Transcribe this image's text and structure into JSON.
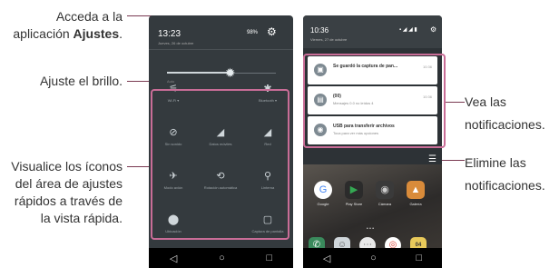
{
  "annotations": {
    "ajustes_pre": "Acceda a la",
    "ajustes_line2_pre": "aplicación ",
    "ajustes_bold": "Ajustes",
    "ajustes_post": ".",
    "brillo": "Ajuste el brillo.",
    "quick_1": "Visualice los íconos",
    "quick_2": "del área de ajustes",
    "quick_3": "rápidos a través de",
    "quick_4": "la vista rápida.",
    "notif_1": "Vea las",
    "notif_2": "notificaciones.",
    "clear_1": "Elimine las",
    "clear_2": "notificaciones."
  },
  "colors": {
    "callout": "#7a3a52",
    "highlight": "#c96d97",
    "phone_bg": "#343a3e"
  },
  "left_phone": {
    "time": "13:23",
    "date": "Jueves, 26 de octubre",
    "battery": "98%",
    "brightness_level": 0.58,
    "tiles": [
      {
        "icon": "wifi-icon",
        "glyph": "⚟",
        "label": "Wi-Fi ▾"
      },
      {
        "icon": "bluetooth-icon",
        "glyph": "✱",
        "label": "Bluetooth ▾"
      },
      {
        "icon": "no-sound-icon",
        "glyph": "⊘",
        "label": "Sin sonido"
      },
      {
        "icon": "data-icon",
        "glyph": "◢",
        "label": "Datos móviles"
      },
      {
        "icon": "signal-icon",
        "glyph": "◢",
        "label": "Red"
      },
      {
        "icon": "airplane-icon",
        "glyph": "✈",
        "label": "Modo avión"
      },
      {
        "icon": "rotate-icon",
        "glyph": "⟲",
        "label": "Rotación automática"
      },
      {
        "icon": "flashlight-icon",
        "glyph": "⚲",
        "label": "Linterna"
      },
      {
        "icon": "location-icon",
        "glyph": "⬤",
        "label": "Ubicación"
      },
      {
        "icon": "capture-icon",
        "glyph": "▢",
        "label": "Captura de pantalla"
      }
    ]
  },
  "right_phone": {
    "time": "10:36",
    "date": "Viernes, 27 de octubre",
    "notifications": [
      {
        "title": "Se guardó la captura de pan...",
        "sub": "",
        "time": "10:36"
      },
      {
        "title": "(00)",
        "sub": "Mensajes 0.0 no leídos 4",
        "time": "10:36"
      },
      {
        "title": "USB para transferir archivos",
        "sub": "Toca para ver más opciones",
        "time": ""
      }
    ],
    "apps_row1": [
      "Google",
      "Play Store",
      "Cámara",
      "Galería"
    ],
    "apps_row2": [
      "Teléfono",
      "Contactos",
      "Mensajes",
      "Chrome",
      "Calendario"
    ],
    "calendar_day": "04"
  },
  "nav": {
    "back": "◁",
    "home": "○",
    "recent": "□"
  }
}
